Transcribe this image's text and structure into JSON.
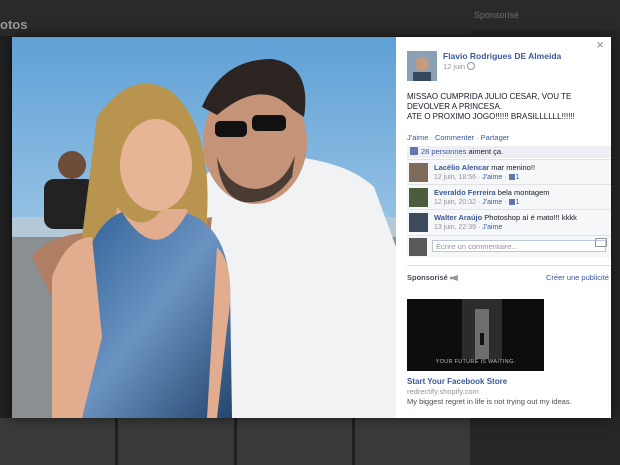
{
  "background": {
    "page_title": "otos",
    "sponsor_label": "Sponsorisé"
  },
  "post": {
    "author": "Flavio Rodrigues DE Almeida",
    "date": "12 juin",
    "text_lines": [
      "MISSAO CUMPRIDA JULIO CESAR, VOU TE",
      "DEVOLVER A PRINCESA.",
      "ATE O PROXIMO JOGO!!!!!! BRASILLLLLL!!!!!!"
    ],
    "actions": [
      "J'aime",
      "Commenter",
      "Partager"
    ],
    "likes_link": "28 personnes",
    "likes_text": " aiment ça."
  },
  "comments": [
    {
      "name": "Lacélio Alencar",
      "text": " mar menino!!",
      "time": "12 juin, 18:56",
      "like_label": "J'aime",
      "likes": "1"
    },
    {
      "name": "Everaldo Ferreira",
      "text": " bela montagem",
      "time": "12 juin, 20:32",
      "like_label": "J'aime",
      "likes": "1"
    },
    {
      "name": "Walter Araújo",
      "text": " Photoshop aí é mato!!! kkkk",
      "time": "13 juin, 22:39",
      "like_label": "J'aime",
      "likes": ""
    }
  ],
  "comment_box": {
    "placeholder": "Écrire un commentaire..."
  },
  "sponsored": {
    "label": "Sponsorisé",
    "create_ad": "Créer une publicité",
    "ad_image_caption": "YOUR FUTURE IS WAITING.",
    "ad_title": "Start Your Facebook Store",
    "ad_domain": "redrectify.shopify.com",
    "ad_body": "My biggest regret in life is not trying out my ideas."
  },
  "close_symbol": "×",
  "icons": [
    "close-icon",
    "globe-icon",
    "like-thumb-icon",
    "camera-icon",
    "megaphone-icon"
  ],
  "colors": {
    "link": "#3b5998",
    "muted": "#90949c",
    "like_bar": "#edeff4",
    "overlay": "#1b1b1b"
  }
}
